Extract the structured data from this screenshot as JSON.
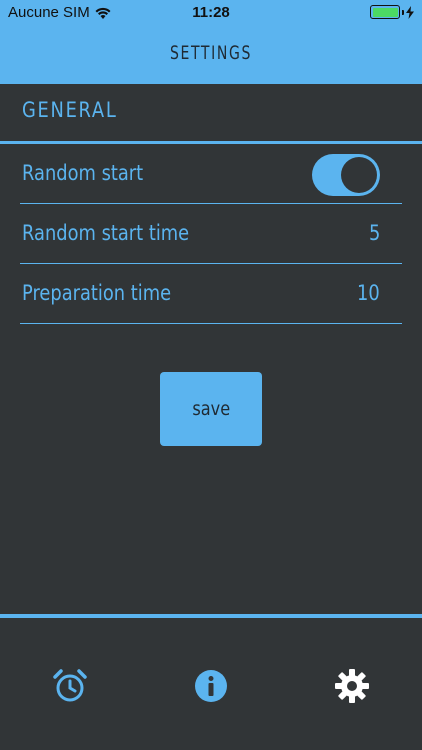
{
  "status_bar": {
    "carrier": "Aucune SIM",
    "time": "11:28",
    "wifi_icon": "wifi-icon",
    "battery_icon": "battery-icon",
    "charging_icon": "bolt-icon"
  },
  "header": {
    "title": "SETTINGS"
  },
  "section": {
    "title": "GENERAL"
  },
  "settings": {
    "random_start": {
      "label": "Random start",
      "enabled": true
    },
    "random_start_time": {
      "label": "Random start time",
      "value": "5"
    },
    "preparation_time": {
      "label": "Preparation time",
      "value": "10"
    }
  },
  "actions": {
    "save_label": "save"
  },
  "tabs": [
    {
      "icon": "alarm-clock-icon"
    },
    {
      "icon": "info-icon"
    },
    {
      "icon": "gear-icon",
      "active": true
    }
  ],
  "colors": {
    "accent": "#5bb4ef",
    "background": "#313537",
    "battery": "#4cd964",
    "active_tab_icon": "#ffffff"
  }
}
